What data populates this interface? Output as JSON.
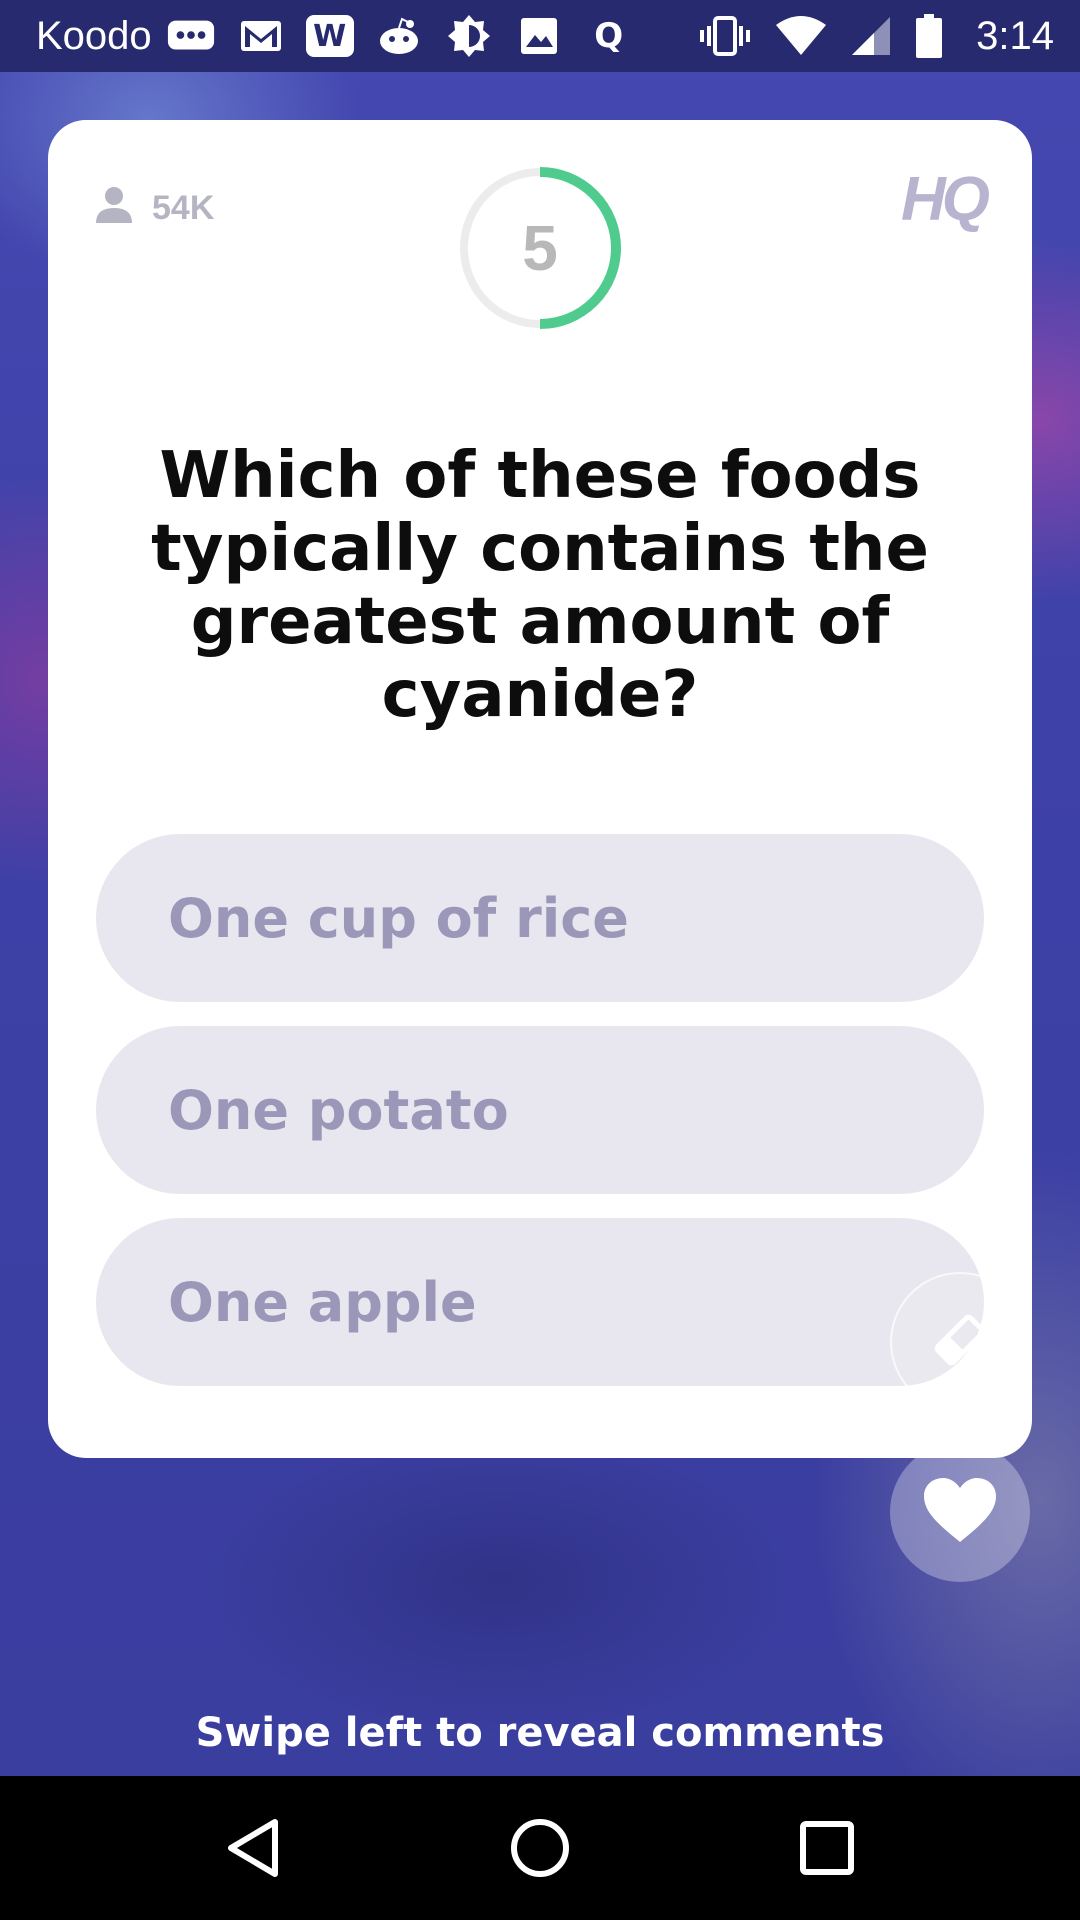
{
  "status_bar": {
    "carrier": "Koodo",
    "time": "3:14",
    "notification_icons": [
      "messages-icon",
      "gmail-icon",
      "word-icon",
      "reddit-icon",
      "brightness-icon",
      "photos-icon",
      "quora-icon"
    ],
    "word_icon_letter": "W",
    "quora_icon_letter": "Q"
  },
  "card": {
    "viewer_count": "54K",
    "timer_seconds": "5",
    "timer_remaining_fraction": 0.5,
    "logo": "HQ",
    "question": "Which of these foods typically contains the greatest amount of cyanide?",
    "answers": [
      "One cup of rice",
      "One potato",
      "One apple"
    ]
  },
  "swipe_hint": "Swipe left to reveal comments",
  "colors": {
    "timer_progress": "#4ecb8d",
    "answer_bg": "#e8e7ef",
    "answer_text": "#9a97b8",
    "background": "#3d40a6"
  }
}
